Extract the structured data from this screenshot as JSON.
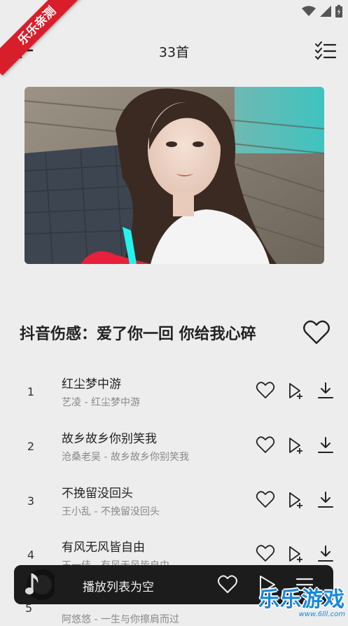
{
  "corner_badge": "乐乐亲测",
  "header": {
    "title": "33首"
  },
  "playlist": {
    "title": "抖音伤感：爱了你一回 你给我心碎"
  },
  "songs": [
    {
      "index": "1",
      "name": "红尘梦中游",
      "subtitle": "艺凌 - 红尘梦中游"
    },
    {
      "index": "2",
      "name": "故乡故乡你别笑我",
      "subtitle": "沧桑老吴 - 故乡故乡你别笑我"
    },
    {
      "index": "3",
      "name": "不挽留没回头",
      "subtitle": "王小乱 - 不挽留没回头"
    },
    {
      "index": "4",
      "name": "有风无风皆自由",
      "subtitle": "王一佳 - 有风无风皆自由"
    }
  ],
  "partial_song": {
    "index": "5",
    "subtitle": "阿悠悠 - 一生与你擦肩而过"
  },
  "player": {
    "text": "播放列表为空"
  },
  "watermark": {
    "main": "乐乐游戏",
    "url": "www.6lll.com"
  },
  "colors": {
    "accent": "#d81e2b",
    "player_bg": "#1c1c1c",
    "watermark": "#1a8ad8"
  }
}
